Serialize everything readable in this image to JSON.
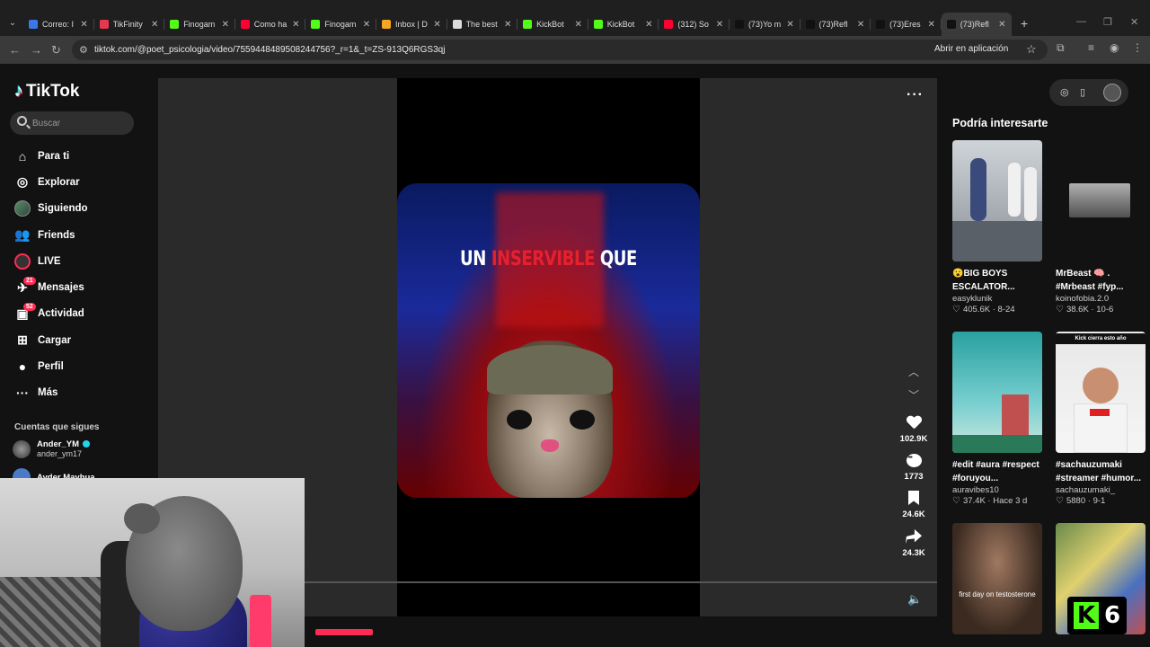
{
  "browser": {
    "tabs": [
      {
        "title": "Correo: I",
        "favicon": "#3b78e7",
        "active": false
      },
      {
        "title": "TikFinity",
        "favicon": "#e8384f",
        "active": false
      },
      {
        "title": "Finogam",
        "favicon": "#53fc18",
        "active": false
      },
      {
        "title": "Como ha",
        "favicon": "#ff0033",
        "active": false
      },
      {
        "title": "Finogam",
        "favicon": "#53fc18",
        "active": false
      },
      {
        "title": "Inbox | D",
        "favicon": "#f5a623",
        "active": false
      },
      {
        "title": "The best",
        "favicon": "#dddddd",
        "active": false
      },
      {
        "title": "KickBot",
        "favicon": "#53fc18",
        "active": false
      },
      {
        "title": "KickBot",
        "favicon": "#53fc18",
        "active": false
      },
      {
        "title": "(312) So",
        "favicon": "#ff0033",
        "active": false
      },
      {
        "title": "(73)Yo m",
        "favicon": "#111111",
        "active": false
      },
      {
        "title": "(73)Refl",
        "favicon": "#111111",
        "active": false
      },
      {
        "title": "(73)Eres",
        "favicon": "#111111",
        "active": false
      },
      {
        "title": "(73)Refl",
        "favicon": "#111111",
        "active": true
      }
    ],
    "url": "tiktok.com/@poet_psicologia/video/7559448489508244756?_r=1&_t=ZS-913Q6RGS3qj",
    "open_in_app": "Abrir en aplicación"
  },
  "sidebar": {
    "logo": "TikTok",
    "search_placeholder": "Buscar",
    "nav": [
      {
        "label": "Para ti",
        "icon": "home-icon",
        "glyph": "⌂"
      },
      {
        "label": "Explorar",
        "icon": "compass-icon",
        "glyph": "◎"
      },
      {
        "label": "Siguiendo",
        "icon": "following-avatar-icon",
        "glyph": ""
      },
      {
        "label": "Friends",
        "icon": "friends-icon",
        "glyph": "👥"
      },
      {
        "label": "LIVE",
        "icon": "live-icon",
        "glyph": ""
      },
      {
        "label": "Mensajes",
        "icon": "messages-icon",
        "glyph": "✈",
        "badge": "21"
      },
      {
        "label": "Actividad",
        "icon": "activity-icon",
        "glyph": "▣",
        "badge": "52"
      },
      {
        "label": "Cargar",
        "icon": "upload-icon",
        "glyph": "⊞"
      },
      {
        "label": "Perfil",
        "icon": "profile-icon",
        "glyph": "●"
      },
      {
        "label": "Más",
        "icon": "more-icon",
        "glyph": "···"
      }
    ],
    "following_title": "Cuentas que sigues",
    "following": [
      {
        "name": "Ander_YM",
        "handle": "ander_ym17",
        "verified": true
      },
      {
        "name": "Ayder Mayhua",
        "handle": "",
        "verified": false
      }
    ]
  },
  "video": {
    "caption_pre": "UN ",
    "caption_highlight": "INSERVIBLE",
    "caption_post": " QUE",
    "likes": "102.9K",
    "comments": "1773",
    "saves": "24.6K",
    "shares": "24.3K"
  },
  "recommendations": {
    "title": "Podría interesarte",
    "items": [
      {
        "title": "😮BIG BOYS ESCALATOR...",
        "author": "easyklunik",
        "likes": "405.6K",
        "date": "8-24",
        "overlay": ""
      },
      {
        "title": "MrBeast 🧠 . #Mrbeast #fyp...",
        "author": "koinofobia.2.0",
        "likes": "38.6K",
        "date": "10-6",
        "overlay": ""
      },
      {
        "title": "#edit #aura #respect #foruyou...",
        "author": "auravibes10",
        "likes": "37.4K",
        "date": "Hace 3 d",
        "overlay": ""
      },
      {
        "title": "#sachauzumaki #streamer #humor...",
        "author": "sachauzumaki_",
        "likes": "5880",
        "date": "9-1",
        "overlay": "Kick cierra esto año"
      },
      {
        "title": "",
        "author": "",
        "likes": "",
        "date": "",
        "overlay": "first day on testosterone"
      },
      {
        "title": "",
        "author": "",
        "likes": "",
        "date": "",
        "overlay": ""
      }
    ]
  },
  "kick_badge": {
    "number": "6"
  }
}
